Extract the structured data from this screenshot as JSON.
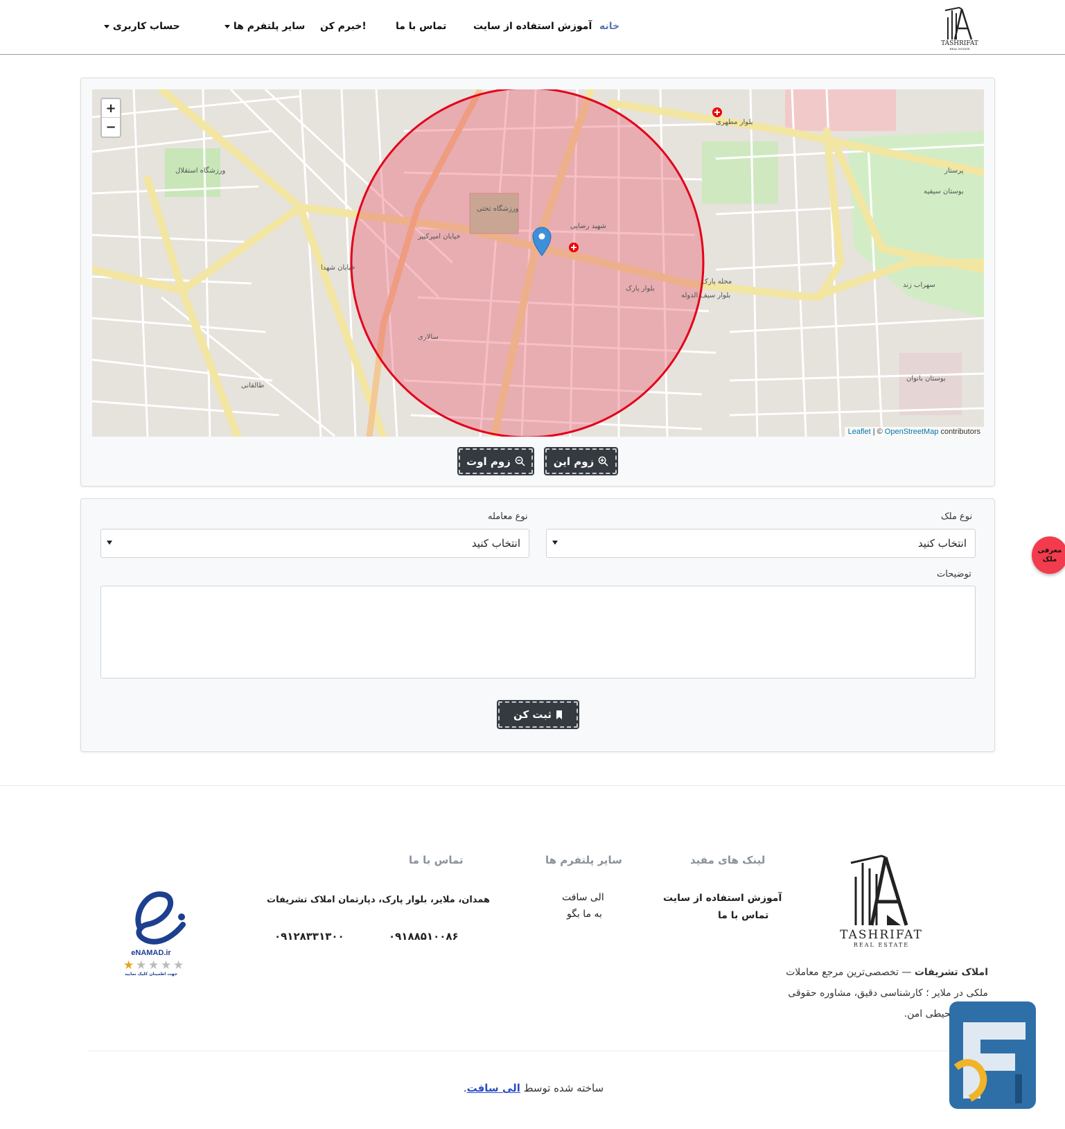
{
  "nav": {
    "home": "خانه",
    "tutorial": "آموزش استفاده از سایت",
    "contact": "تماس با ما",
    "inform": "خبرم کن!",
    "platforms": "سایر پلتفرم ها",
    "account": "حساب کاربری",
    "logo_text": "TASHRIFAT",
    "logo_sub": "REAL ESTATE"
  },
  "map": {
    "zoom_in": "+",
    "zoom_out": "−",
    "attribution_leaflet": "Leaflet",
    "attribution_sep": "| ©",
    "attribution_osm": "OpenStreetMap",
    "attribution_contrib": "contributors",
    "street_labels": {
      "l1": "بلوار مطهری",
      "l2": "بلوار سیف الدوله",
      "l3": "خیابان امیرکبیر",
      "l4": "ورزشگاه تختی",
      "l5": "ورزشگاه استقلال",
      "l6": "بوستان سیفیه",
      "l7": "پرستار",
      "l8": "سهراب زند",
      "l9": "خیابان شهدا",
      "l10": "طالقانی",
      "l11": "محله پارک",
      "l12": "بوستان بانوان",
      "l13": "شهید رضایی",
      "l14": "بلوار پارک",
      "l15": "سالاری"
    },
    "zoom_in_button": "زوم این",
    "zoom_out_button": "زوم اوت"
  },
  "form": {
    "property_type_label": "نوع ملک",
    "property_type_value": "انتخاب کنید",
    "deal_type_label": "نوع معامله",
    "deal_type_value": "انتخاب کنید",
    "description_label": "توضیحات",
    "submit": "ثبت کن"
  },
  "fab": "معرفی ملک",
  "footer": {
    "logo_text": "TASHRIFAT",
    "logo_sub": "REAL ESTATE",
    "useful_links_title": "لینک های مفید",
    "useful_links": [
      "آموزش استفاده از سایت",
      "تماس با ما"
    ],
    "platforms_title": "سایر پلتفرم ها",
    "platforms": [
      "الی سافت",
      "به ما بگو"
    ],
    "contact_title": "تماس با ما",
    "address": "همدان، ملایر، بلوار پارک، دپارتمان املاک تشریفات",
    "phone1": "۰۹۱۸۸۵۱۰۰۸۶",
    "phone2": "۰۹۱۲۸۳۳۱۳۰۰",
    "about_bold": "املاک تشریفات",
    "about_text": " — تخصصی‌ترین مرجع معاملات ملکی در ملایر ؛ کارشناسی دقیق، مشاوره حقوقی و ... در محیطی امن.",
    "enamad_text": "eNAMAD.ir",
    "enamad_caption": "جهت اطمینان کلیک نمایید",
    "credit_prefix": "ساخته شده توسط",
    "credit_link": "الی سافت",
    "credit_suffix": "."
  },
  "colors": {
    "accent_nav": "#5a79b4",
    "button_dark": "#343a40",
    "circle_stroke": "#e3001b",
    "circle_fill": "#e84a5f",
    "fab": "#f23b4c",
    "link": "#2b4cc8"
  },
  "icons": {
    "zoom_in_icon": "magnifier-plus",
    "zoom_out_icon": "magnifier-minus",
    "bookmark_icon": "bookmark",
    "marker_icon": "map-pin"
  }
}
